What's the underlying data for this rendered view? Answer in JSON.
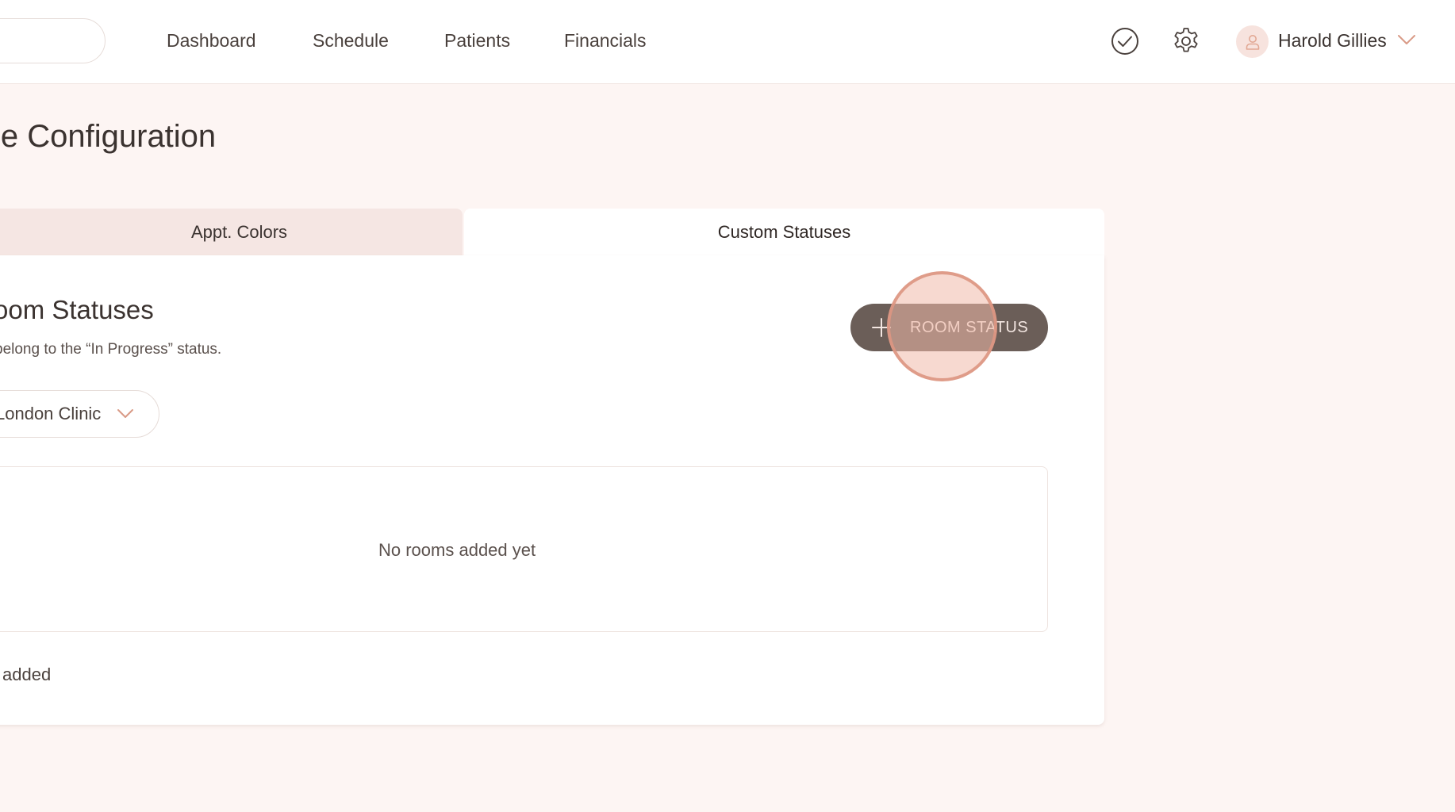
{
  "nav": {
    "items": [
      "Dashboard",
      "Schedule",
      "Patients",
      "Financials"
    ]
  },
  "header": {
    "user_name": "Harold Gillies",
    "icons": [
      "check-circle-icon",
      "gear-icon",
      "user-icon",
      "chevron-down-icon"
    ]
  },
  "page": {
    "title": "le Configuration"
  },
  "tabs": [
    {
      "label": "Appt. Colors",
      "active": false
    },
    {
      "label": "Custom Statuses",
      "active": true
    }
  ],
  "section": {
    "title": "oom Statuses",
    "description": "belong to the “In Progress” status.",
    "clinic_select": "London Clinic",
    "add_button_label": "ROOM STATUS",
    "empty_rooms": "No rooms added yet",
    "footer_text": "added"
  },
  "colors": {
    "background": "#fdf5f3",
    "button": "#6b5e58",
    "accent": "#d99a86",
    "tab_inactive": "#f5e6e3"
  }
}
